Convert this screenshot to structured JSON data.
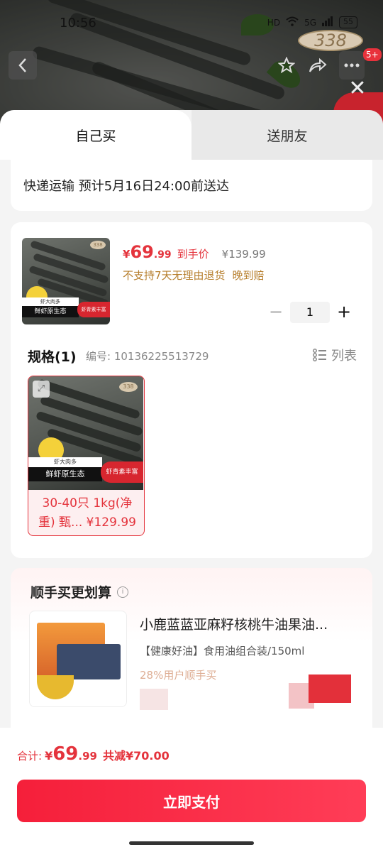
{
  "status_bar": {
    "time": "10:56",
    "signal_labels": [
      "HD",
      "5G"
    ],
    "battery": "55"
  },
  "hero": {
    "price_bubble": "338",
    "notification_count": "5+"
  },
  "tabs": [
    {
      "label": "自己买",
      "active": true
    },
    {
      "label": "送朋友",
      "active": false
    }
  ],
  "delivery": {
    "text": "快递运输 预计5月16日24:00前送达"
  },
  "product": {
    "currency": "¥",
    "price_int": "69",
    "price_dec": ".99",
    "price_label": "到手价",
    "original_price": "¥139.99",
    "policy_1": "不支持7天无理由退货",
    "policy_2": "晚到赔",
    "thumb_label_small": "虾大肉多",
    "thumb_label_main": "鲜虾原生态",
    "thumb_label_red": "虾青素丰富",
    "thumb_tag": "338",
    "quantity": "1",
    "minus": "−",
    "plus": "+"
  },
  "spec": {
    "title": "规格(1)",
    "code": "编号: 10136225513729",
    "list_toggle": "列表",
    "option": {
      "text": "30-40只 1kg(净重) 甄... ¥129.99",
      "label_small": "虾大肉多",
      "label_main": "鲜虾原生态",
      "label_red": "虾青素丰富",
      "tag": "338"
    }
  },
  "bundle": {
    "title": "顺手买更划算",
    "product_name": "小鹿蓝蓝亚麻籽核桃牛油果油...",
    "product_sub": "【健康好油】食用油组合装/150ml",
    "promo": "28%用户顺手买"
  },
  "footer": {
    "total_label": "合计:",
    "currency": "¥",
    "total_int": "69",
    "total_dec": ".99",
    "discount": "共减¥70.00",
    "pay_button": "立即支付"
  },
  "colors": {
    "accent_red": "#e4333c",
    "pay_gradient_start": "#f51f3a",
    "pay_gradient_end": "#ff3d57",
    "policy_gold": "#b67e2c"
  }
}
